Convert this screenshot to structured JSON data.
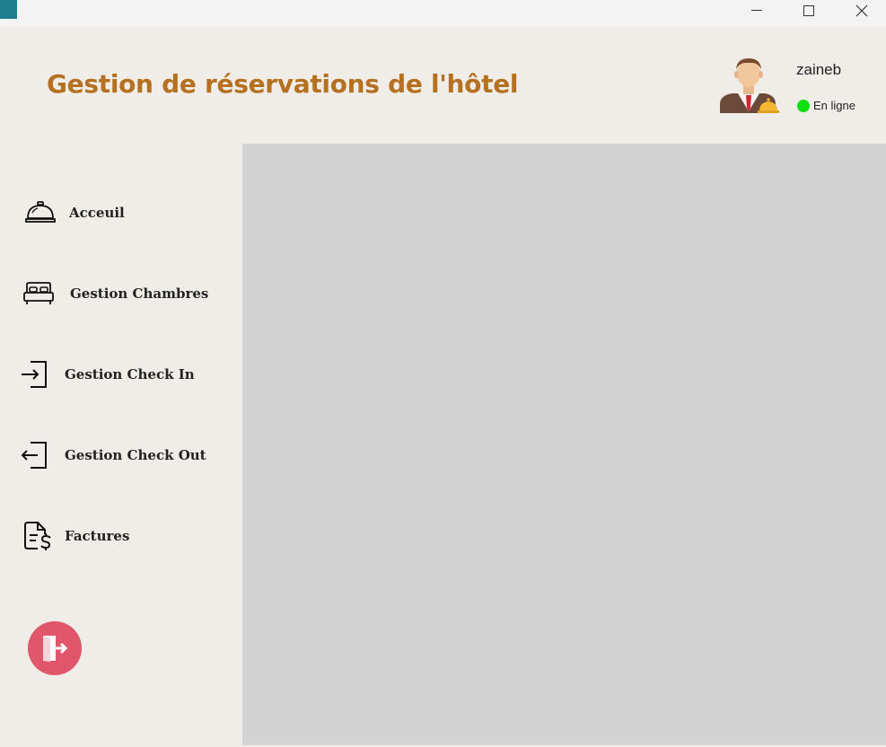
{
  "window": {
    "app_icon": "hotel-app-icon",
    "controls": {
      "minimize": "minimize-icon",
      "maximize": "maximize-icon",
      "close": "close-icon"
    }
  },
  "header": {
    "title": "Gestion de réservations de l'hôtel",
    "title_color": "#b5711f",
    "user": {
      "name": "zaineb",
      "status": "En ligne",
      "status_color": "#10e010",
      "avatar_icon": "receptionist-avatar-icon"
    }
  },
  "sidebar": {
    "items": [
      {
        "label": "Acceuil",
        "icon": "service-bell-icon"
      },
      {
        "label": "Gestion Chambres",
        "icon": "bed-icon"
      },
      {
        "label": "Gestion Check In",
        "icon": "check-in-icon"
      },
      {
        "label": "Gestion Check Out",
        "icon": "check-out-icon"
      },
      {
        "label": "Factures",
        "icon": "invoice-icon"
      }
    ],
    "logout_icon": "logout-door-icon",
    "logout_color": "#e0566a"
  },
  "main": {
    "background": "#d3d3d3"
  }
}
